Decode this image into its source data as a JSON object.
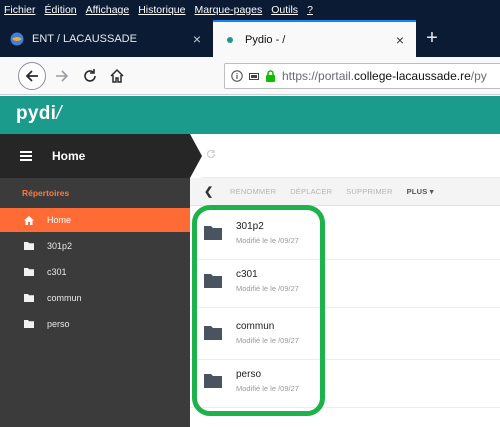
{
  "menubar": {
    "items": [
      "Fichier",
      "Édition",
      "Affichage",
      "Historique",
      "Marque-pages",
      "Outils",
      "?"
    ]
  },
  "tabs": [
    {
      "title": "ENT / LACAUSSADE",
      "close": "×"
    },
    {
      "title": "Pydio - /",
      "close": "×"
    }
  ],
  "newtab_label": "+",
  "navbar": {
    "back": "←",
    "forward": "→",
    "reload": "C",
    "home": "⌂",
    "url_prefix": "https://portail.",
    "url_domain": "college-lacaussade.re",
    "url_suffix": "/py"
  },
  "app": {
    "logo": "pydi",
    "logo_mark": "/",
    "header_color": "#1a9b8b"
  },
  "sidebar": {
    "title": "Home",
    "section": "Répertoires",
    "items": [
      {
        "label": "Home",
        "icon": "home-icon",
        "active": true
      },
      {
        "label": "301p2",
        "icon": "folder-icon",
        "active": false
      },
      {
        "label": "c301",
        "icon": "folder-icon",
        "active": false
      },
      {
        "label": "commun",
        "icon": "folder-icon",
        "active": false
      },
      {
        "label": "perso",
        "icon": "folder-icon",
        "active": false
      }
    ]
  },
  "actionbar": {
    "back": "❮",
    "actions": [
      "RENOMMER",
      "DÉPLACER",
      "SUPPRIMER"
    ],
    "more": "PLUS ▾"
  },
  "files": [
    {
      "name": "301p2",
      "meta": "Modifié le le /09/27"
    },
    {
      "name": "c301",
      "meta": "Modifié le le /09/27"
    },
    {
      "name": "commun",
      "meta": "Modifié le le /09/27"
    },
    {
      "name": "perso",
      "meta": "Modifié le le /09/27"
    }
  ],
  "colors": {
    "accent": "#ff6b35",
    "highlight": "#1db24a",
    "folder": "#4a5360"
  }
}
